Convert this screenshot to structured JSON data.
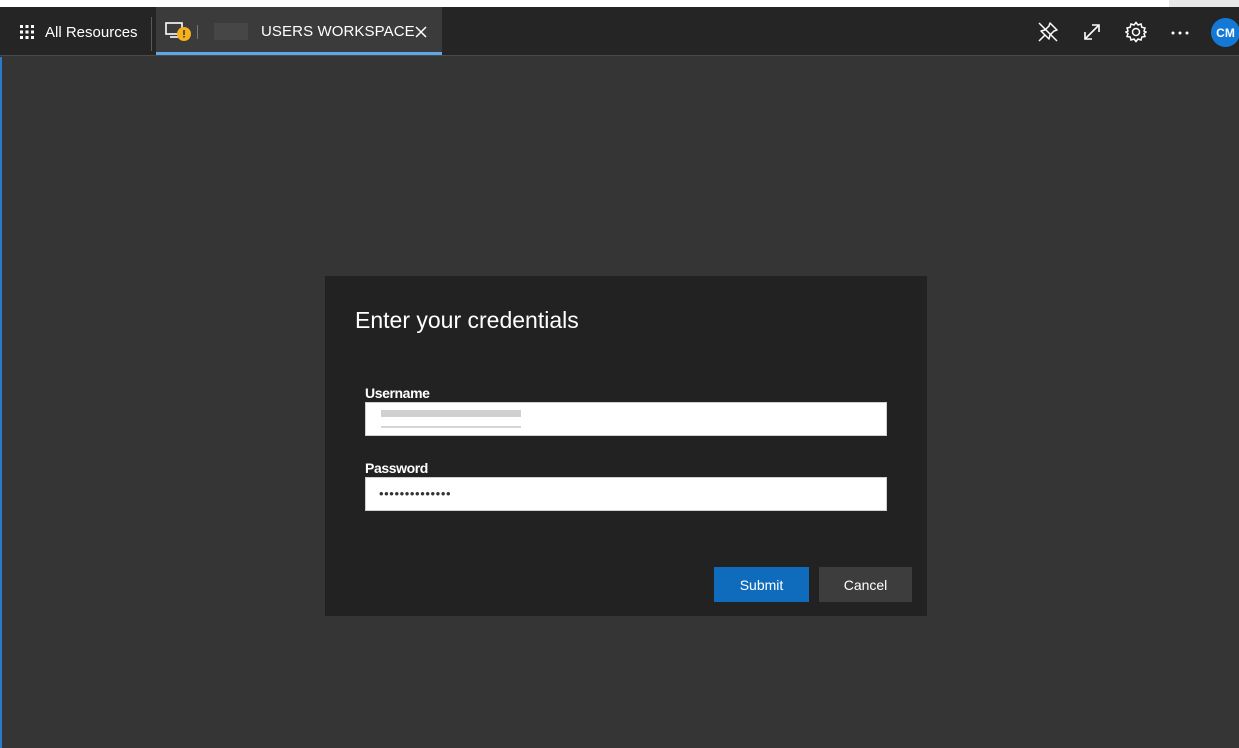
{
  "topbar": {
    "all_resources_label": "All Resources",
    "tab": {
      "title": "USERS WORKSPACE",
      "icon": "remote-desktop-warning-icon",
      "close_icon": "close-icon"
    },
    "actions": [
      {
        "name": "unpin-icon"
      },
      {
        "name": "fullscreen-icon"
      },
      {
        "name": "settings-icon"
      },
      {
        "name": "more-icon"
      }
    ],
    "avatar_initials": "CM"
  },
  "dialog": {
    "title": "Enter your credentials",
    "username_label": "Username",
    "username_value": "",
    "password_label": "Password",
    "password_display": "••••••••••••••",
    "submit_label": "Submit",
    "cancel_label": "Cancel"
  },
  "colors": {
    "accent": "#0f6cbd",
    "tab_underline": "#5ea7e8",
    "warning_badge": "#f5b21b",
    "avatar": "#1479d6"
  }
}
